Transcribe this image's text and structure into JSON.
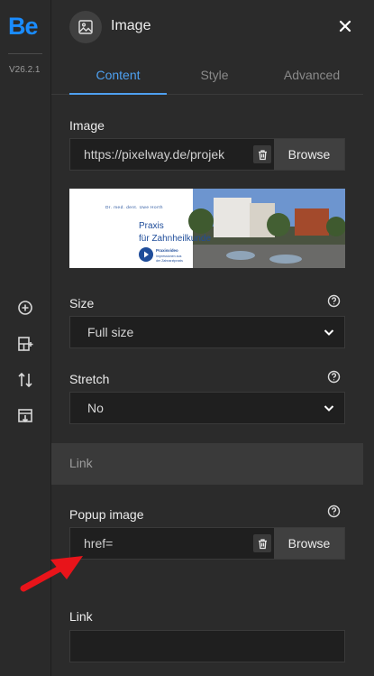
{
  "rail": {
    "logo": "Be",
    "version": "V26.2.1",
    "icons": [
      "add-circle-icon",
      "layout-add-icon",
      "sort-arrows-icon",
      "import-icon"
    ]
  },
  "header": {
    "title": "Image",
    "icon": "image-icon",
    "close_icon": "close-icon"
  },
  "tabs": [
    {
      "label": "Content",
      "active": true
    },
    {
      "label": "Style",
      "active": false
    },
    {
      "label": "Advanced",
      "active": false
    }
  ],
  "image_field": {
    "label": "Image",
    "value": "https://pixelway.de/projek",
    "browse_label": "Browse"
  },
  "thumbnail": {
    "heading_small": "Dr. med. dent. Uwe Horth",
    "title_line1": "Praxis",
    "title_line2": "für Zahnheilkunde",
    "badge_title": "Praxisvideo",
    "badge_sub1": "Impressionen aus",
    "badge_sub2": "der Zahnarztpraxis"
  },
  "size_field": {
    "label": "Size",
    "value": "Full size"
  },
  "stretch_field": {
    "label": "Stretch",
    "value": "No"
  },
  "section_link": {
    "label": "Link"
  },
  "popup_field": {
    "label": "Popup image",
    "value": "href=",
    "browse_label": "Browse"
  },
  "link_field": {
    "label": "Link",
    "value": ""
  },
  "colors": {
    "accent": "#4ea0f0",
    "logo": "#1a8cff",
    "arrow": "#e8141a"
  }
}
